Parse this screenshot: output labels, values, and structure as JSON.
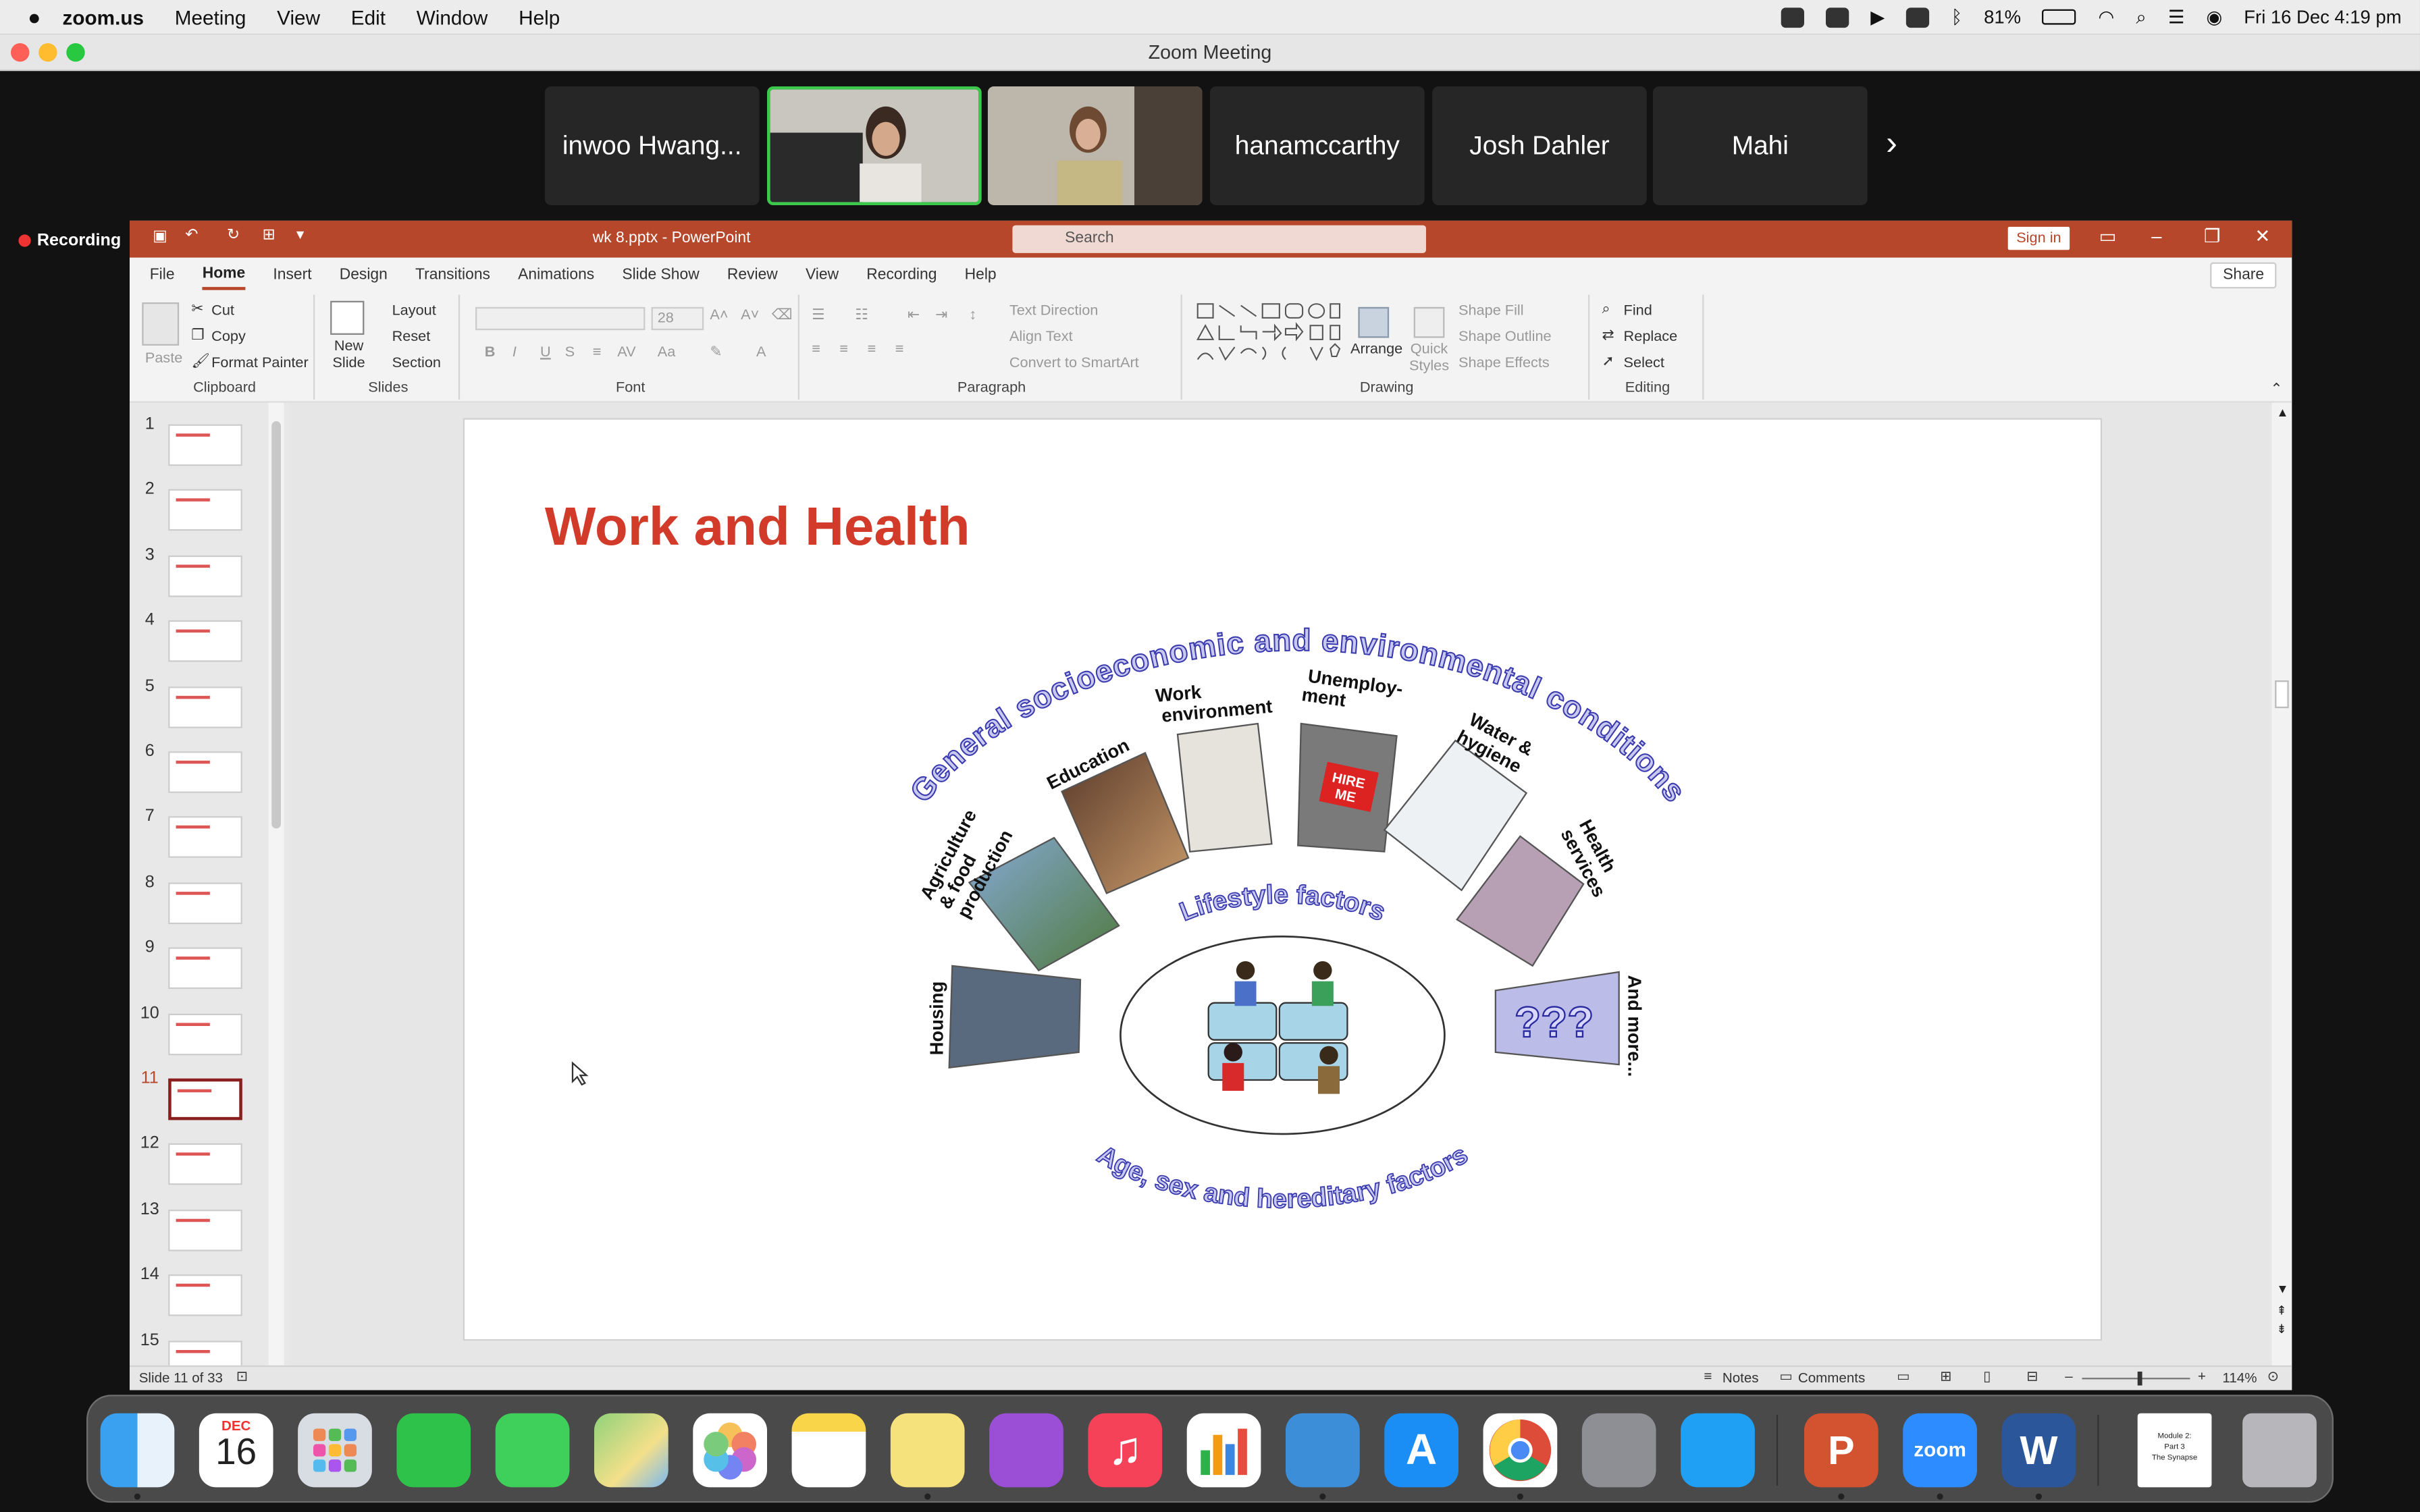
{
  "menubar": {
    "app_name": "zoom.us",
    "items": [
      "Meeting",
      "View",
      "Edit",
      "Window",
      "Help"
    ],
    "battery": "81%",
    "clock": "Fri 16 Dec  4:19 pm"
  },
  "zoom": {
    "window_title": "Zoom Meeting",
    "recording_label": "Recording",
    "participants": [
      "inwoo Hwang...",
      "hanamccarthy",
      "Josh Dahler",
      "Mahi"
    ],
    "next_glyph": "›"
  },
  "ppt": {
    "file_title": "wk 8.pptx  -  PowerPoint",
    "search_placeholder": "Search",
    "sign_in": "Sign in",
    "share": "Share",
    "tabs": [
      "File",
      "Home",
      "Insert",
      "Design",
      "Transitions",
      "Animations",
      "Slide Show",
      "Review",
      "View",
      "Recording",
      "Help"
    ],
    "active_tab": "Home",
    "ribbon": {
      "clipboard": {
        "label": "Clipboard",
        "paste": "Paste",
        "cut": "Cut",
        "copy": "Copy",
        "format_painter": "Format Painter"
      },
      "slides": {
        "label": "Slides",
        "new_slide": "New Slide",
        "layout": "Layout",
        "reset": "Reset",
        "section": "Section"
      },
      "font": {
        "label": "Font",
        "size": "28"
      },
      "paragraph": {
        "label": "Paragraph",
        "text_direction": "Text Direction",
        "align_text": "Align Text",
        "convert_smartart": "Convert to SmartArt"
      },
      "drawing": {
        "label": "Drawing",
        "arrange": "Arrange",
        "quick_styles": "Quick Styles",
        "shape_fill": "Shape Fill",
        "shape_outline": "Shape Outline",
        "shape_effects": "Shape Effects"
      },
      "editing": {
        "label": "Editing",
        "find": "Find",
        "replace": "Replace",
        "select": "Select"
      }
    },
    "thumbnail_numbers": [
      "1",
      "2",
      "3",
      "4",
      "5",
      "6",
      "7",
      "8",
      "9",
      "10",
      "11",
      "12",
      "13",
      "14",
      "15"
    ],
    "selected_slide": "11",
    "slide": {
      "title": "Work and Health",
      "arc_top": "General socioeconomic and environmental conditions",
      "arc_bottom": "Age, sex and hereditary factors",
      "lifestyle": "Lifestyle factors",
      "question_marks": "???",
      "labels": {
        "agriculture": [
          "Agriculture",
          "& food",
          "production"
        ],
        "education": "Education",
        "work": [
          "Work",
          "environment"
        ],
        "unemployment": [
          "Unemploy-",
          "ment"
        ],
        "water": [
          "Water &",
          "hygiene"
        ],
        "health": [
          "Health",
          "services"
        ],
        "housing": "Housing",
        "more": "And more..."
      },
      "hire_me": [
        "HIRE",
        "ME"
      ]
    },
    "status": {
      "slide_info": "Slide 11 of 33",
      "notes": "Notes",
      "comments": "Comments",
      "zoom": "114%"
    }
  },
  "dock": {
    "calendar_month": "DEC",
    "calendar_day": "16",
    "zoom_label": "zoom",
    "pages_doc": [
      "Module 2:",
      "Part 3",
      "The Synapse"
    ],
    "apps": [
      "finder-icon",
      "calendar-icon",
      "launchpad-icon",
      "facetime-icon",
      "messages-icon",
      "maps-icon",
      "photos-icon",
      "notes-icon",
      "stickies-icon",
      "podcasts-icon",
      "music-icon",
      "numbers-icon",
      "keynote-icon",
      "appstore-icon",
      "chrome-icon",
      "settings-icon",
      "safari-icon",
      "powerpoint-icon",
      "zoom-icon",
      "word-icon",
      "document-icon",
      "trash-icon"
    ]
  }
}
